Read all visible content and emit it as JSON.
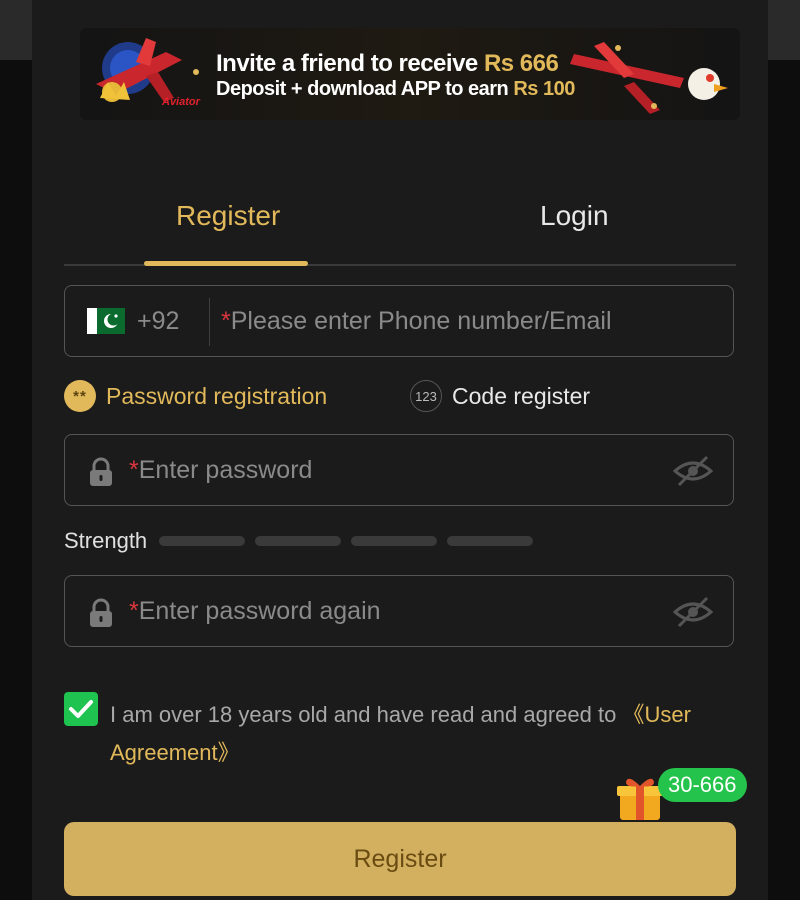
{
  "banner": {
    "line1_text": "Invite a friend to receive",
    "line1_amount": "Rs 666",
    "line2_text": "Deposit + download APP to earn",
    "line2_amount": "Rs 100",
    "logo_text": "Aviator"
  },
  "tabs": {
    "register_label": "Register",
    "login_label": "Login",
    "active": "register"
  },
  "phone": {
    "country_flag": "pakistan-flag-icon",
    "country_code": "+92",
    "required_mark": "*",
    "placeholder": "Please enter Phone number/Email"
  },
  "modes": {
    "password_icon_text": "**",
    "password_label": "Password registration",
    "code_icon_text": "123",
    "code_label": "Code register",
    "active": "password"
  },
  "password": {
    "required_mark": "*",
    "placeholder": "Enter password"
  },
  "strength": {
    "label": "Strength",
    "level": 0,
    "segments": 4
  },
  "password_confirm": {
    "required_mark": "*",
    "placeholder": "Enter password again"
  },
  "agreement": {
    "checked": true,
    "text": "I am over 18 years old and have read and agreed to ",
    "link_text": "《User Agreement》"
  },
  "gift": {
    "badge_text": "30-666"
  },
  "register_button": {
    "label": "Register"
  },
  "colors": {
    "accent_gold": "#e2b95a",
    "background": "#1b1b1b",
    "checkbox_green": "#1fc34f",
    "button_gold": "#d3b060",
    "required_red": "#d9363e"
  }
}
